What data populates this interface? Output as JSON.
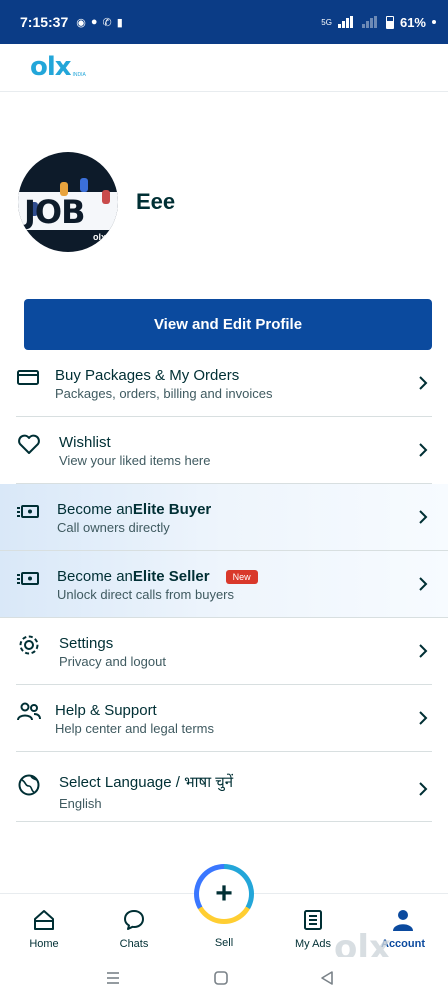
{
  "status_bar": {
    "time": "7:15:37",
    "network": "5G",
    "battery": "61%"
  },
  "header": {
    "logo_text": "olx",
    "logo_sub": "INDIA"
  },
  "profile": {
    "avatar_text": "JOB",
    "avatar_brand": "olx",
    "name": "Eee",
    "edit_button_label": "View and Edit Profile"
  },
  "menu": {
    "items": [
      {
        "title": "Buy Packages & My Orders",
        "subtitle": "Packages, orders, billing and invoices",
        "icon": "card-icon"
      },
      {
        "title": "Wishlist",
        "subtitle": "View your liked items here",
        "icon": "heart-icon"
      },
      {
        "title_prefix": "Become an ",
        "title_bold": "Elite Buyer",
        "subtitle": "Call owners directly",
        "icon": "elite-icon"
      },
      {
        "title_prefix": "Become an ",
        "title_bold": "Elite Seller",
        "badge": "New",
        "subtitle": "Unlock direct calls from buyers",
        "icon": "elite-icon"
      },
      {
        "title": "Settings",
        "subtitle": "Privacy and logout",
        "icon": "gear-icon"
      },
      {
        "title": "Help & Support",
        "subtitle": "Help center and legal terms",
        "icon": "people-icon"
      },
      {
        "title": "Select Language / भाषा चुनें",
        "subtitle": "English",
        "icon": "globe-icon"
      }
    ]
  },
  "bottom_nav": {
    "home": "Home",
    "chats": "Chats",
    "sell": "Sell",
    "my_ads": "My Ads",
    "account": "Account",
    "watermark": "olx"
  },
  "colors": {
    "primary": "#0b4a9e",
    "status_bar": "#0b3c86",
    "logo": "#23a6d9",
    "badge": "#d9392b"
  }
}
